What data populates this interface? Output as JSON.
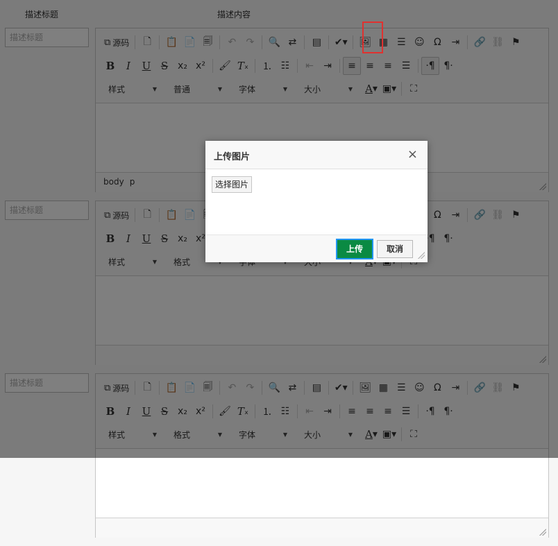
{
  "headers": {
    "title_col": "描述标题",
    "content_col": "描述内容"
  },
  "rows": [
    {
      "title_placeholder": "描述标题",
      "path": [
        "body",
        "p"
      ]
    },
    {
      "title_placeholder": "描述标题",
      "path": []
    },
    {
      "title_placeholder": "描述标题",
      "path": []
    }
  ],
  "toolbar": {
    "source_label": "源码",
    "combos": {
      "styles": "样式",
      "format_row1": "普通",
      "format_other": "格式",
      "font": "字体",
      "size": "大小"
    }
  },
  "dialog": {
    "title": "上传图片",
    "close": "×",
    "choose_label": "选择图片",
    "ok_label": "上传",
    "cancel_label": "取消"
  },
  "colors": {
    "highlight": "#e0312f",
    "ok_button": "#0a8a43",
    "focus_ring": "#2196f3"
  }
}
